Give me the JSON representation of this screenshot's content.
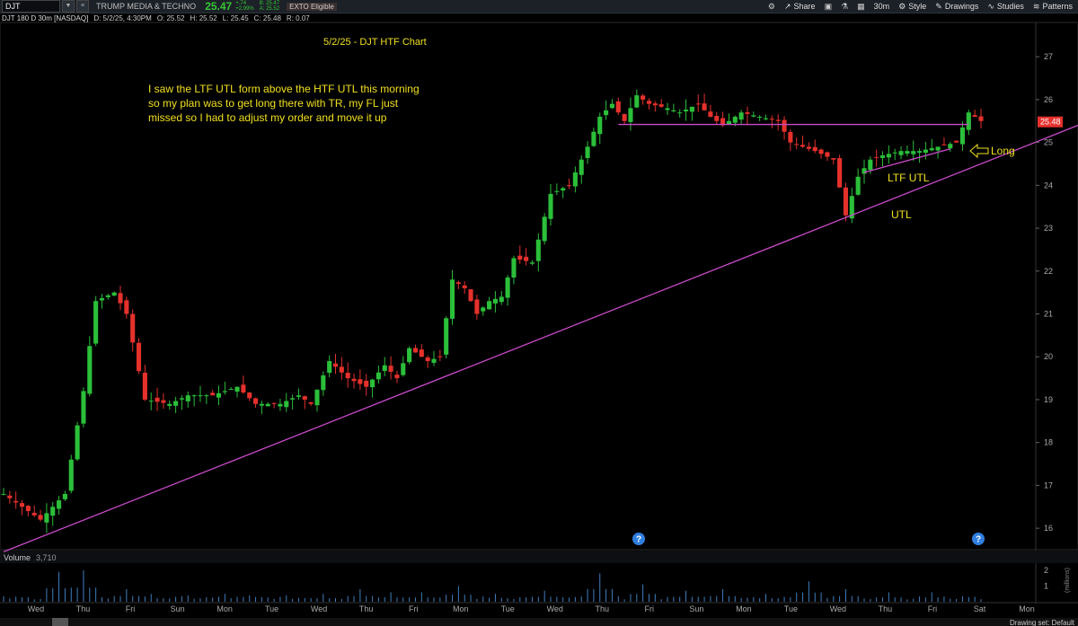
{
  "toolbar": {
    "symbol": "DJT",
    "company": "TRUMP MEDIA & TECHNO",
    "last": "25.47",
    "change_abs": "+.74",
    "change_pct": "+2.99%",
    "bid": "B: 25.47",
    "ask": "A: 25.52",
    "eto": "EXTO Eligible",
    "share": "Share",
    "period": "30m",
    "style": "Style",
    "drawings": "Drawings",
    "studies": "Studies",
    "patterns": "Patterns"
  },
  "header": {
    "title": "DJT 180 D 30m [NASDAQ]",
    "date": "D: 5/2/25, 4:30PM",
    "open": "O: 25.52",
    "high": "H: 25.52",
    "low": "L: 25.45",
    "close": "C: 25.48",
    "range": "R: 0.07"
  },
  "volume": {
    "label": "Volume",
    "value": "3,710",
    "unit": "(millions)"
  },
  "footer": {
    "drawing_set": "Drawing set: Default"
  },
  "colors": {
    "up": "#2bbf3a",
    "down": "#e5312c",
    "trendline": "#c94ac9",
    "annotation": "#f0e020",
    "bg": "#000000"
  },
  "chart_data": {
    "type": "candlestick",
    "title": "5/2/25 - DJT HTF Chart",
    "ylim": [
      15.5,
      27.8
    ],
    "yticks": [
      16,
      17,
      18,
      19,
      20,
      21,
      22,
      23,
      24,
      25,
      26,
      27
    ],
    "last_price_label": "25.48",
    "x_day_labels": [
      "Wed",
      "Thu",
      "Fri",
      "Sun",
      "Mon",
      "Tue",
      "Wed",
      "Thu",
      "Fri",
      "Mon",
      "Tue",
      "Wed",
      "Thu",
      "Fri",
      "Sun",
      "Mon",
      "Tue",
      "Wed",
      "Thu",
      "Fri",
      "Sat",
      "Mon"
    ],
    "price_path": [
      [
        0,
        16.8
      ],
      [
        6,
        16.2
      ],
      [
        10,
        16.8
      ],
      [
        13,
        19.2
      ],
      [
        15,
        21.3
      ],
      [
        18,
        21.5
      ],
      [
        20,
        21.0
      ],
      [
        23,
        19.0
      ],
      [
        27,
        18.9
      ],
      [
        30,
        19.1
      ],
      [
        34,
        19.1
      ],
      [
        38,
        19.3
      ],
      [
        41,
        18.9
      ],
      [
        45,
        18.9
      ],
      [
        48,
        19.1
      ],
      [
        50,
        18.9
      ],
      [
        53,
        19.9
      ],
      [
        56,
        19.5
      ],
      [
        59,
        19.3
      ],
      [
        62,
        19.8
      ],
      [
        64,
        19.5
      ],
      [
        66,
        20.2
      ],
      [
        69,
        19.9
      ],
      [
        71,
        20.0
      ],
      [
        73,
        21.8
      ],
      [
        75,
        21.6
      ],
      [
        77,
        21.0
      ],
      [
        79,
        21.3
      ],
      [
        81,
        21.4
      ],
      [
        83,
        22.3
      ],
      [
        86,
        22.2
      ],
      [
        89,
        23.8
      ],
      [
        92,
        24.0
      ],
      [
        95,
        24.9
      ],
      [
        97,
        25.6
      ],
      [
        99,
        25.9
      ],
      [
        101,
        25.5
      ],
      [
        103,
        26.1
      ],
      [
        105,
        25.9
      ],
      [
        108,
        25.8
      ],
      [
        110,
        25.7
      ],
      [
        113,
        25.9
      ],
      [
        115,
        25.6
      ],
      [
        117,
        25.4
      ],
      [
        120,
        25.7
      ],
      [
        123,
        25.6
      ],
      [
        126,
        25.5
      ],
      [
        128,
        25.0
      ],
      [
        130,
        24.9
      ],
      [
        132,
        24.8
      ],
      [
        135,
        24.6
      ],
      [
        137,
        23.3
      ],
      [
        139,
        24.2
      ],
      [
        141,
        24.6
      ],
      [
        143,
        24.7
      ],
      [
        146,
        24.8
      ],
      [
        149,
        24.8
      ],
      [
        152,
        24.9
      ],
      [
        155,
        25.0
      ],
      [
        157,
        25.7
      ],
      [
        159,
        25.5
      ]
    ],
    "volume_peaks": [
      [
        9,
        1.9
      ],
      [
        13,
        2.0
      ],
      [
        20,
        0.8
      ],
      [
        24,
        0.5
      ],
      [
        30,
        0.4
      ],
      [
        36,
        0.5
      ],
      [
        40,
        0.4
      ],
      [
        46,
        0.4
      ],
      [
        52,
        0.5
      ],
      [
        58,
        0.8
      ],
      [
        63,
        0.6
      ],
      [
        68,
        0.6
      ],
      [
        74,
        1.0
      ],
      [
        80,
        0.5
      ],
      [
        88,
        0.7
      ],
      [
        97,
        1.8
      ],
      [
        104,
        1.1
      ],
      [
        111,
        0.7
      ],
      [
        117,
        0.8
      ],
      [
        124,
        0.5
      ],
      [
        131,
        1.3
      ],
      [
        137,
        0.8
      ],
      [
        144,
        0.6
      ],
      [
        151,
        0.6
      ],
      [
        157,
        0.3
      ]
    ],
    "vol_yticks": [
      1,
      2
    ],
    "trendlines": {
      "htf_utl": {
        "from": [
          0,
          15.45
        ],
        "to": [
          1200,
          25.4
        ]
      },
      "resistance": {
        "from": [
          100,
          25.42
        ],
        "to": [
          157,
          25.42
        ]
      },
      "ltf_utl": {
        "from": [
          140,
          24.3
        ],
        "to": [
          154,
          24.85
        ]
      }
    },
    "annotations": {
      "note": [
        "I saw the LTF UTL form above the HTF UTL this morning",
        "so my plan was to get long there with TR, my FL just",
        "missed so I had to adjust my order and move it up"
      ],
      "long_label": "Long",
      "ltf_label": "LTF UTL",
      "utl_label": "UTL"
    }
  }
}
